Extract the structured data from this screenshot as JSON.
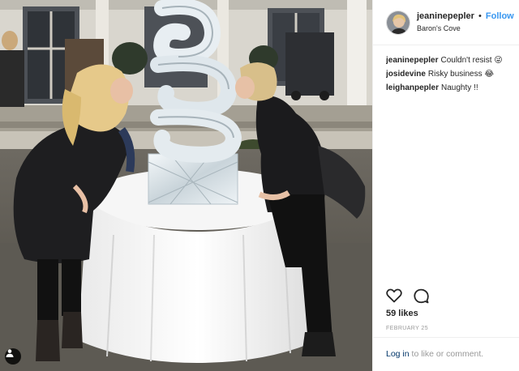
{
  "post": {
    "username": "jeaninepepler",
    "separator": "•",
    "follow_label": "Follow",
    "location": "Baron's Cove"
  },
  "comments": [
    {
      "user": "jeaninepepler",
      "text": "Couldn't resist 😜"
    },
    {
      "user": "josidevine",
      "text": "Risky business 😂"
    },
    {
      "user": "leighanpepler",
      "text": "Naughty !!"
    }
  ],
  "stats": {
    "likes": "59 likes",
    "date": "FEBRUARY 25"
  },
  "footer": {
    "login_link": "Log in",
    "login_suffix": " to like or comment."
  },
  "icons": {
    "like": "heart-outline-icon",
    "comment": "speech-bubble-icon",
    "tag": "person-tag-icon"
  },
  "colors": {
    "accent": "#3897f0",
    "link": "#003569",
    "muted": "#999999",
    "text": "#262626"
  }
}
